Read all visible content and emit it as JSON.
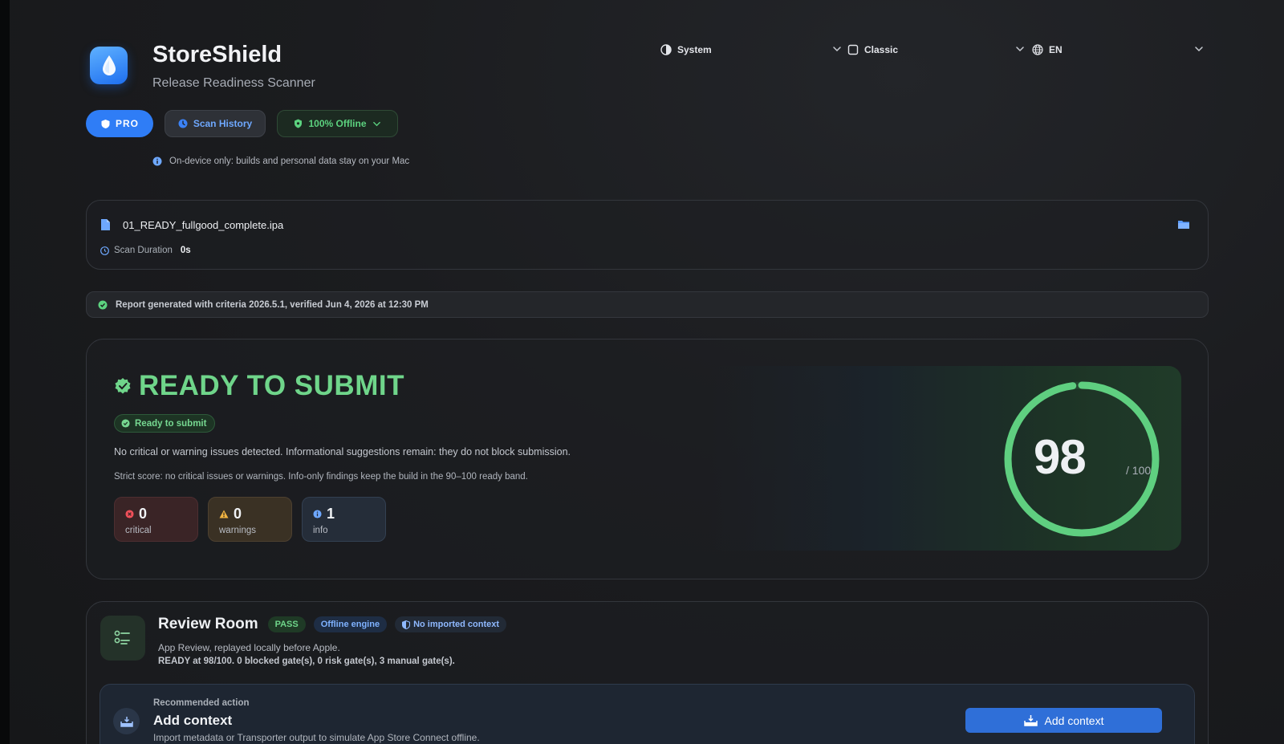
{
  "app": {
    "title": "StoreShield",
    "subtitle": "Release Readiness Scanner",
    "accent": "#2f7df6"
  },
  "selectors": {
    "appearance": "System",
    "theme": "Classic",
    "language": "EN"
  },
  "toolbar": {
    "pro_label": "PRO",
    "history_label": "Scan History",
    "offline_label": "100% Offline",
    "ondevice_note": "On-device only: builds and personal data stay on your Mac"
  },
  "file": {
    "name": "01_READY_fullgood_complete.ipa",
    "duration_label": "Scan Duration",
    "duration_value": "0s"
  },
  "report": {
    "text": "Report generated with criteria 2026.5.1, verified Jun 4, 2026 at 12:30 PM"
  },
  "status": {
    "headline": "READY TO SUBMIT",
    "badge": "Ready to submit",
    "description": "No critical or warning issues detected. Informational suggestions remain: they do not block submission.",
    "strict_note": "Strict score: no critical issues or warnings. Info-only findings keep the build in the 90–100 ready band.",
    "color": "#6fd58a",
    "counts": {
      "critical": {
        "value": "0",
        "label": "critical"
      },
      "warnings": {
        "value": "0",
        "label": "warnings"
      },
      "info": {
        "value": "1",
        "label": "info"
      }
    },
    "score": {
      "value": "98",
      "max": "/ 100",
      "fraction": 0.98
    }
  },
  "review": {
    "title": "Review Room",
    "pill_pass": "PASS",
    "pill_engine": "Offline engine",
    "pill_context": "No imported context",
    "subtitle": "App Review, replayed locally before Apple.",
    "summary": "READY at 98/100. 0 blocked gate(s), 0 risk gate(s), 3 manual gate(s).",
    "recommended": {
      "label": "Recommended action",
      "title": "Add context",
      "description": "Import metadata or Transporter output to simulate App Store Connect offline.",
      "button": "Add context"
    }
  }
}
